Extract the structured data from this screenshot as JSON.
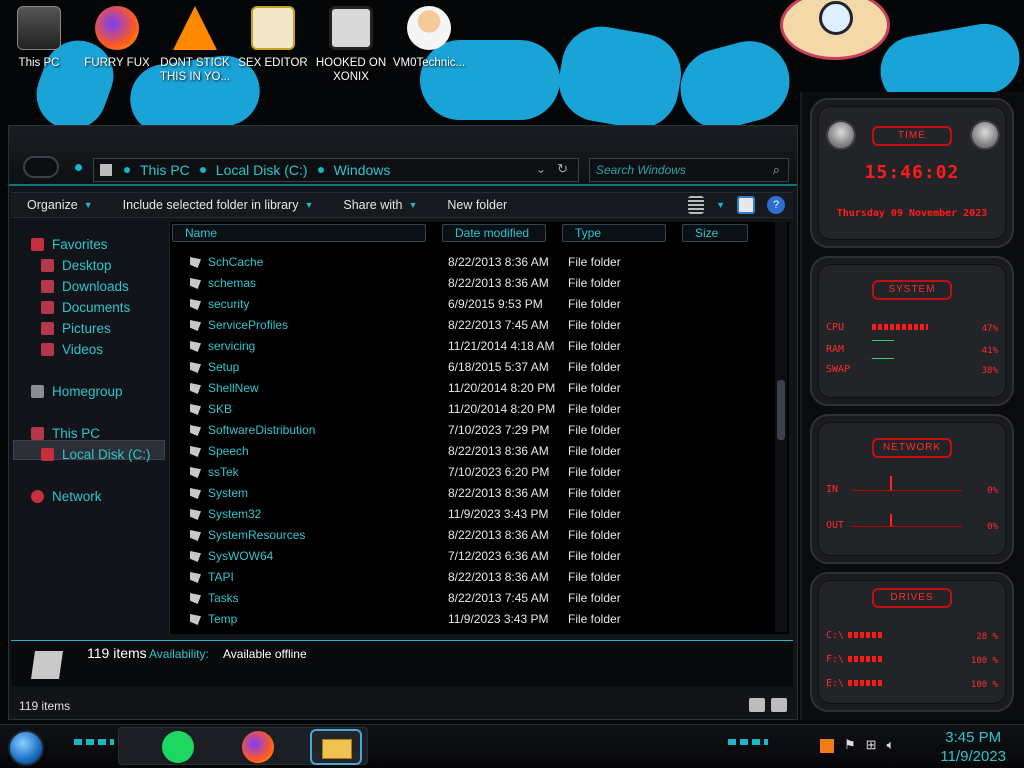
{
  "desktop": {
    "icons": [
      {
        "label": "This PC",
        "icon": "monitor-icon"
      },
      {
        "label": "FURRY FUX",
        "icon": "firefox-icon"
      },
      {
        "label": "DONT STICK THIS IN YO...",
        "icon": "vlc-icon"
      },
      {
        "label": "SEX EDITOR",
        "icon": "hxd-icon"
      },
      {
        "label": "HOOKED ON XONIX",
        "icon": "game-icon"
      },
      {
        "label": "VM0Technic...",
        "icon": "technician-icon"
      }
    ]
  },
  "explorer": {
    "breadcrumb": [
      "This PC",
      "Local Disk (C:)",
      "Windows"
    ],
    "search_placeholder": "Search Windows",
    "toolbar": {
      "organize": "Organize",
      "include": "Include selected folder in library",
      "share": "Share with",
      "new_folder": "New folder"
    },
    "nav": {
      "favorites": "Favorites",
      "desktop": "Desktop",
      "downloads": "Downloads",
      "documents": "Documents",
      "pictures": "Pictures",
      "videos": "Videos",
      "homegroup": "Homegroup",
      "this_pc": "This PC",
      "local_disk": "Local Disk (C:)",
      "network": "Network"
    },
    "columns": {
      "name": "Name",
      "date": "Date modified",
      "type": "Type",
      "size": "Size"
    },
    "files": [
      {
        "name": "SchCache",
        "date": "8/22/2013 8:36 AM",
        "type": "File folder"
      },
      {
        "name": "schemas",
        "date": "8/22/2013 8:36 AM",
        "type": "File folder"
      },
      {
        "name": "security",
        "date": "6/9/2015 9:53 PM",
        "type": "File folder"
      },
      {
        "name": "ServiceProfiles",
        "date": "8/22/2013 7:45 AM",
        "type": "File folder"
      },
      {
        "name": "servicing",
        "date": "11/21/2014 4:18 AM",
        "type": "File folder"
      },
      {
        "name": "Setup",
        "date": "6/18/2015 5:37 AM",
        "type": "File folder"
      },
      {
        "name": "ShellNew",
        "date": "11/20/2014 8:20 PM",
        "type": "File folder"
      },
      {
        "name": "SKB",
        "date": "11/20/2014 8:20 PM",
        "type": "File folder"
      },
      {
        "name": "SoftwareDistribution",
        "date": "7/10/2023 7:29 PM",
        "type": "File folder"
      },
      {
        "name": "Speech",
        "date": "8/22/2013 8:36 AM",
        "type": "File folder"
      },
      {
        "name": "ssTek",
        "date": "7/10/2023 6:20 PM",
        "type": "File folder"
      },
      {
        "name": "System",
        "date": "8/22/2013 8:36 AM",
        "type": "File folder"
      },
      {
        "name": "System32",
        "date": "11/9/2023 3:43 PM",
        "type": "File folder"
      },
      {
        "name": "SystemResources",
        "date": "8/22/2013 8:36 AM",
        "type": "File folder"
      },
      {
        "name": "SysWOW64",
        "date": "7/12/2023 6:36 AM",
        "type": "File folder"
      },
      {
        "name": "TAPI",
        "date": "8/22/2013 8:36 AM",
        "type": "File folder"
      },
      {
        "name": "Tasks",
        "date": "8/22/2013 7:45 AM",
        "type": "File folder"
      },
      {
        "name": "Temp",
        "date": "11/9/2023 3:43 PM",
        "type": "File folder"
      }
    ],
    "details": {
      "count": "119 items",
      "availability_label": "Availability:",
      "availability_value": "Available offline"
    },
    "status": "119 items"
  },
  "gadgets": {
    "time": {
      "title": "TIME",
      "clock": "15:46:02",
      "date": "Thursday 09 November 2023"
    },
    "system": {
      "title": "SYSTEM",
      "cpu_label": "CPU",
      "cpu_val": "47%",
      "ram_label": "RAM",
      "ram_val": "41%",
      "swap_label": "SWAP",
      "swap_val": "38%"
    },
    "network": {
      "title": "NETWORK",
      "in_label": "IN",
      "in_val": "0%",
      "out_label": "OUT",
      "out_val": "0%"
    },
    "drives": {
      "title": "DRIVES",
      "c_label": "C:\\",
      "c_val": "28 %",
      "f_label": "F:\\",
      "f_val": "100 %",
      "e_label": "E:\\",
      "e_val": "100 %"
    }
  },
  "taskbar": {
    "time": "3:45 PM",
    "date": "11/9/2023"
  },
  "colors": {
    "accent": "#2ec5cf",
    "gadget_red": "#ff1b1b"
  }
}
